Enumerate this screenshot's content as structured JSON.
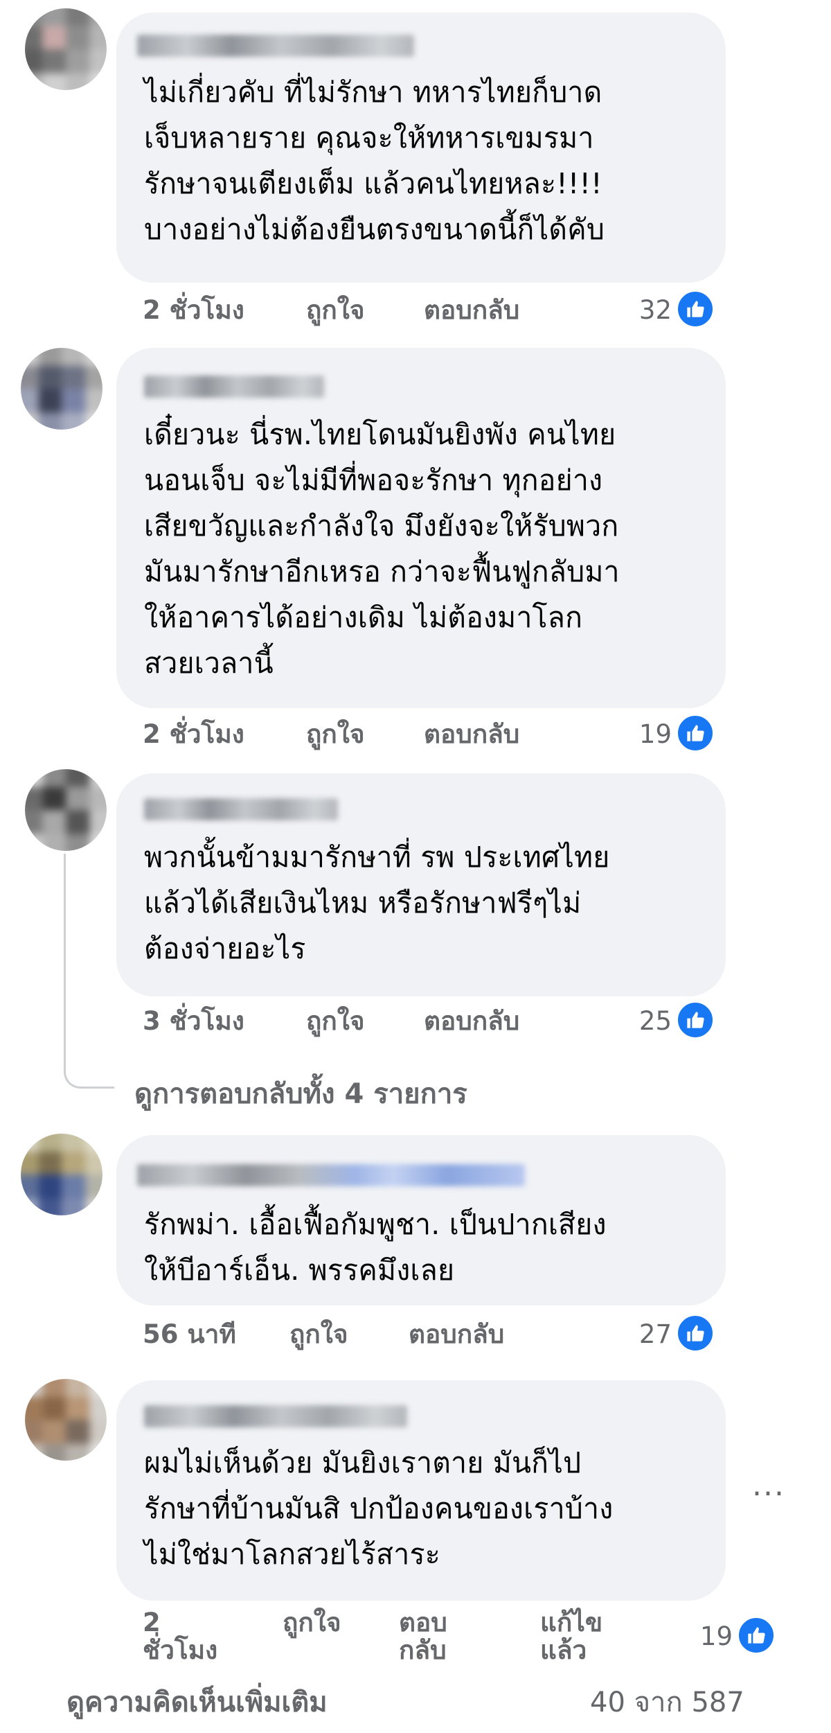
{
  "comments": [
    {
      "text": "ไม่เกี่ยวคับ ที่ไม่รักษา ทหารไทยก็บาด\nเจ็บหลายราย คุณจะให้ทหารเขมรมา\nรักษาจนเตียงเต็ม แล้วคนไทยหละ!!!!\nบางอย่างไม่ต้องยืนตรงขนาดนี้ก็ได้คับ",
      "time": "2 ชั่วโมง",
      "like_label": "ถูกใจ",
      "reply_label": "ตอบกลับ",
      "reactions": "32"
    },
    {
      "text": "เดี๋ยวนะ นี่รพ.ไทยโดนมันยิงพัง คนไทย\nนอนเจ็บ จะไม่มีที่พอจะรักษา ทุกอย่าง\nเสียขวัญและกำลังใจ มึงยังจะให้รับพวก\nมันมารักษาอีกเหรอ กว่าจะฟื้นฟูกลับมา\nให้อาคารได้อย่างเดิม ไม่ต้องมาโลก\nสวยเวลานี้",
      "time": "2 ชั่วโมง",
      "like_label": "ถูกใจ",
      "reply_label": "ตอบกลับ",
      "reactions": "19"
    },
    {
      "text": "พวกนั้นข้ามมารักษาที่ รพ ประเทศไทย\nแล้วได้เสียเงินไหม หรือรักษาฟรีๆไม่\nต้องจ่ายอะไร",
      "time": "3 ชั่วโมง",
      "like_label": "ถูกใจ",
      "reply_label": "ตอบกลับ",
      "reactions": "25"
    },
    {
      "text": "รักพม่า. เอื้อเฟื้อกัมพูชา. เป็นปากเสียง\nให้บีอาร์เอ็น. พรรคมึงเลย",
      "time": "56 นาที",
      "like_label": "ถูกใจ",
      "reply_label": "ตอบกลับ",
      "reactions": "27"
    },
    {
      "text": "ผมไม่เห็นด้วย มันยิงเราตาย มันก็ไป\nรักษาที่บ้านมันสิ ปกป้องคนของเราบ้าง\nไม่ใช่มาโลกสวยไร้สาระ",
      "time": "2\nชั่วโมง",
      "like_label": "ถูกใจ",
      "reply_label": "ตอบ\nกลับ",
      "edited_label": "แก้ไข\nแล้ว",
      "reactions": "19"
    }
  ],
  "view_replies": "ดูการตอบกลับทั้ง 4 รายการ",
  "more_options": "...",
  "footer": {
    "view_more": "ดูความคิดเห็นเพิ่มเติม",
    "count": "40 จาก 587"
  },
  "colors": {
    "bubble": "#f0f2f5",
    "meta_text": "#65676b",
    "like_blue": "#1877f2"
  },
  "icons": {
    "like": "thumbs-up-icon",
    "more": "more-dots-icon"
  }
}
